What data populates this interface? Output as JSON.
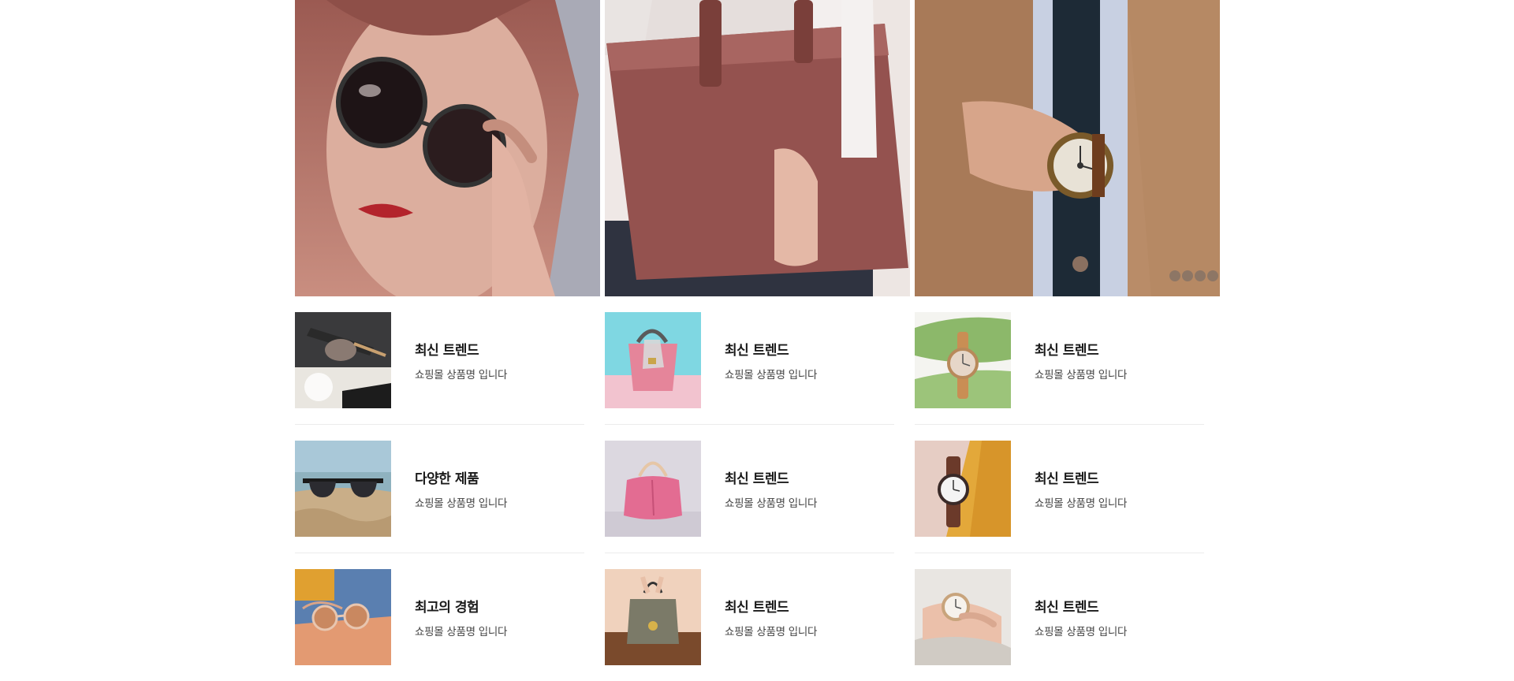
{
  "banners": [
    {
      "icon": "sunglasses-model-photo"
    },
    {
      "icon": "leather-tote-photo"
    },
    {
      "icon": "wristwatch-suit-photo"
    }
  ],
  "products": [
    {
      "title": "최신 트렌드",
      "desc": "쇼핑몰 상품명 입니다",
      "icon": "sunglasses-thumbnail"
    },
    {
      "title": "최신 트렌드",
      "desc": "쇼핑몰 상품명 입니다",
      "icon": "pink-handbag-thumbnail"
    },
    {
      "title": "최신 트렌드",
      "desc": "쇼핑몰 상품명 입니다",
      "icon": "watch-on-leaf-thumbnail"
    },
    {
      "title": "다양한 제품",
      "desc": "쇼핑몰 상품명 입니다",
      "icon": "beach-sunglasses-thumbnail"
    },
    {
      "title": "최신 트렌드",
      "desc": "쇼핑몰 상품명 입니다",
      "icon": "pink-purse-thumbnail"
    },
    {
      "title": "최신 트렌드",
      "desc": "쇼핑몰 상품명 입니다",
      "icon": "brown-watch-thumbnail"
    },
    {
      "title": "최고의 경험",
      "desc": "쇼핑몰 상품명 입니다",
      "icon": "orange-sunglasses-thumbnail"
    },
    {
      "title": "최신 트렌드",
      "desc": "쇼핑몰 상품명 입니다",
      "icon": "grey-handbag-thumbnail"
    },
    {
      "title": "최신 트렌드",
      "desc": "쇼핑몰 상품명 입니다",
      "icon": "wrist-watch-thumbnail"
    }
  ]
}
